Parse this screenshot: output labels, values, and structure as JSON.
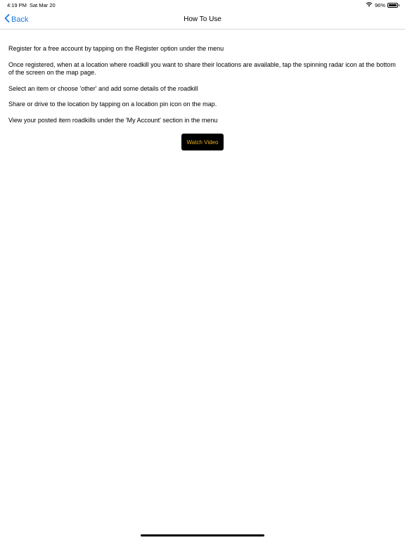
{
  "status_bar": {
    "time": "4:19 PM",
    "date": "Sat Mar 20",
    "battery_percent_label": "96%",
    "battery_level": 0.96,
    "wifi_icon": "wifi-icon",
    "battery_icon": "battery-icon"
  },
  "nav": {
    "back_label": "Back",
    "back_icon": "chevron-left-icon",
    "title": "How To Use",
    "accent_color": "#1a7ae8"
  },
  "instructions": [
    "Register for a free account by tapping on the Register option under the menu",
    "Once registered, when at a location where roadkill you want to share their locations are available, tap the spinning radar icon at the bottom of the screen on the map page.",
    "Select an item or choose 'other' and add some details of the roadkill",
    "Share or drive to the location by tapping on a location pin icon on the map.",
    "View your posted item roadkills under the 'My Account' section in the menu"
  ],
  "watch_video": {
    "label": "Watch Video",
    "background": "#000000",
    "text_color": "#e8b020"
  }
}
